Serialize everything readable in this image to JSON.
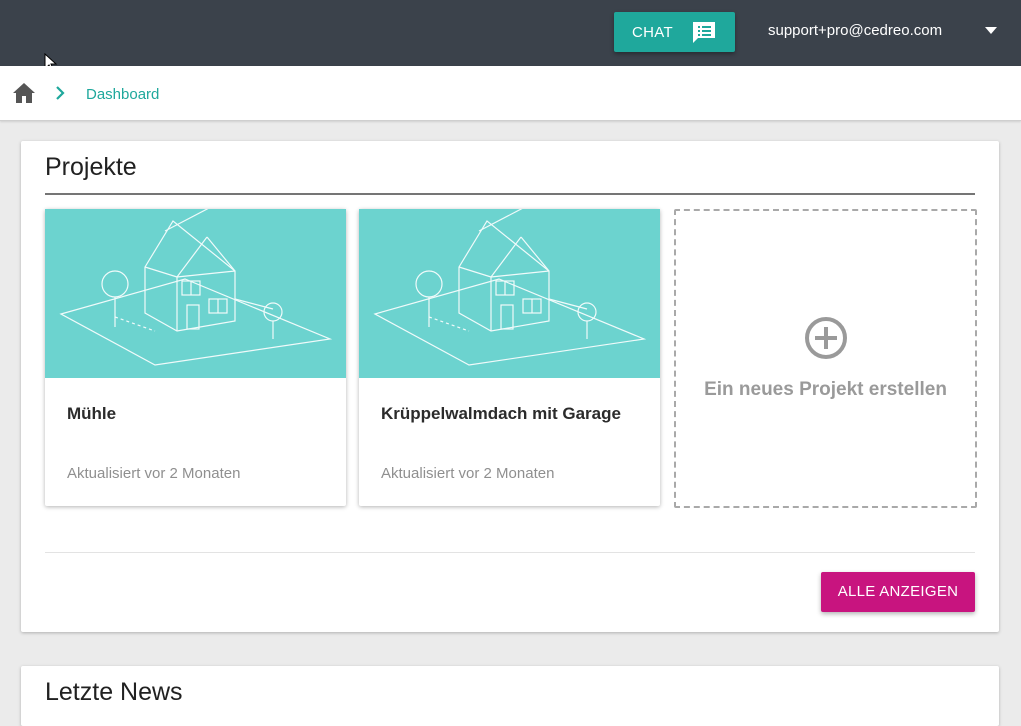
{
  "header": {
    "chat_label": "CHAT",
    "user_email": "support+pro@cedreo.com"
  },
  "breadcrumb": {
    "items": [
      "Dashboard"
    ]
  },
  "projects": {
    "title": "Projekte",
    "items": [
      {
        "name": "Mühle",
        "updated": "Aktualisiert vor 2 Monaten"
      },
      {
        "name": "Krüppelwalmdach mit Garage",
        "updated": "Aktualisiert vor 2 Monaten"
      }
    ],
    "new_label": "Ein neues Projekt erstellen",
    "show_all_label": "ALLE ANZEIGEN"
  },
  "news": {
    "title": "Letzte News"
  },
  "colors": {
    "topbar": "#3b424b",
    "accent_teal": "#1fa89c",
    "thumbnail_bg": "#6cd3cf",
    "primary_button": "#c8147f"
  },
  "icons": [
    "chat-icon",
    "caret-down-icon",
    "home-icon",
    "chevron-right-icon",
    "house-sketch-icon",
    "plus-circle-icon",
    "mouse-cursor-icon"
  ]
}
